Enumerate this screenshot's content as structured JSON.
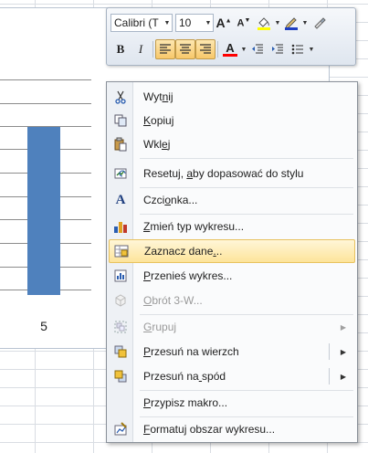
{
  "chart": {
    "category_label": "5"
  },
  "chart_data": {
    "type": "bar",
    "categories": [
      "5"
    ],
    "values": [
      1
    ],
    "title": "",
    "xlabel": "",
    "ylabel": ""
  },
  "toolbar": {
    "font_name": "Calibri (T",
    "font_size": "10",
    "grow_font": "A",
    "shrink_font": "A",
    "bold": "B",
    "italic": "I",
    "font_color_label": "A",
    "fill_color": "#ffff00",
    "font_color": "#ff0000",
    "line_color": "#1f3fc0"
  },
  "menu": {
    "items": [
      {
        "label": "Wytnij",
        "u": 3,
        "icon": "scissors-icon",
        "disabled": false
      },
      {
        "label": "Kopiuj",
        "u": 0,
        "icon": "copy-icon",
        "disabled": false
      },
      {
        "label": "Wklej",
        "u": 3,
        "icon": "paste-icon",
        "disabled": false
      },
      {
        "label": "Resetuj, aby dopasować do stylu",
        "u": 9,
        "icon": "reset-style-icon",
        "disabled": false
      },
      {
        "label": "Czcionka...",
        "u": 4,
        "icon": "font-icon",
        "disabled": false
      },
      {
        "label": "Zmień typ wykresu...",
        "u": 0,
        "icon": "chart-type-icon",
        "disabled": false
      },
      {
        "label": "Zaznacz dane...",
        "u": 12,
        "icon": "select-data-icon",
        "disabled": false
      },
      {
        "label": "Przenieś wykres...",
        "u": 0,
        "icon": "move-chart-icon",
        "disabled": false
      },
      {
        "label": "Obrót 3-W...",
        "u": 0,
        "icon": "rotation-3d-icon",
        "disabled": true
      },
      {
        "label": "Grupuj",
        "u": 0,
        "icon": "group-icon",
        "disabled": true
      },
      {
        "label": "Przesuń na wierzch",
        "u": 0,
        "icon": "bring-front-icon",
        "disabled": false
      },
      {
        "label": "Przesuń na spód",
        "u": 10,
        "icon": "send-back-icon",
        "disabled": false
      },
      {
        "label": "Przypisz makro...",
        "u": 0,
        "icon": "",
        "disabled": false
      },
      {
        "label": "Formatuj obszar wykresu...",
        "u": 0,
        "icon": "format-chart-area-icon",
        "disabled": false
      }
    ]
  }
}
